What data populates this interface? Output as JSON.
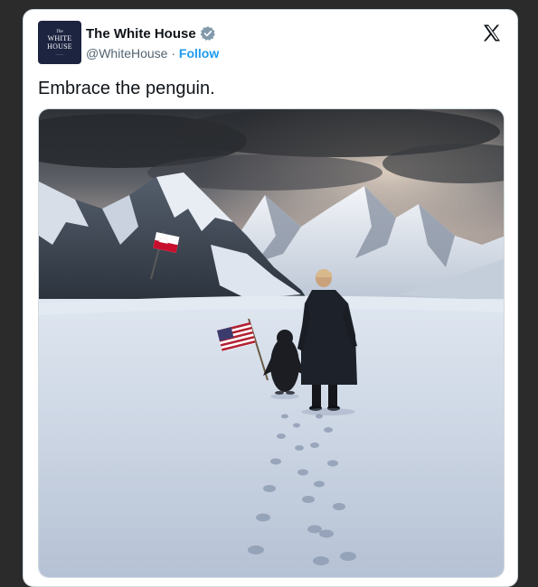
{
  "tweet": {
    "author": {
      "name": "The White House",
      "handle": "@WhiteHouse",
      "follow_label": "Follow",
      "separator": "·",
      "verified": true,
      "avatar": {
        "line_the": "The",
        "line1": "WHITE",
        "line2": "HOUSE"
      }
    },
    "platform_icon": "x-logo-icon",
    "text": "Embrace the penguin.",
    "media": {
      "description_icon": "photo-icon"
    },
    "colors": {
      "accent": "#1d9bf0",
      "text": "#0f1419",
      "muted": "#536471",
      "verified_badge": "#829aab"
    }
  }
}
